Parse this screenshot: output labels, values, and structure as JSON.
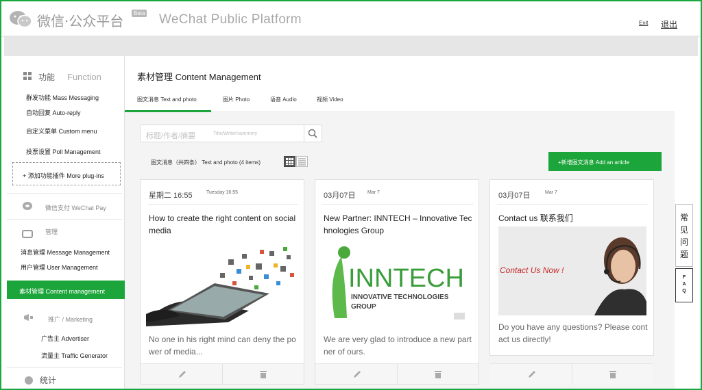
{
  "header": {
    "brand_cn": "微信·公众平台",
    "beta": "Beta",
    "brand_en": "WeChat Public Platform",
    "exit_en": "Exit",
    "exit_cn": "退出"
  },
  "sidebar": {
    "function_cn": "功能",
    "function_en": "Function",
    "items": [
      {
        "label": "群发功能 Mass Messaging"
      },
      {
        "label": "自动回复 Auto-reply"
      },
      {
        "label": "自定义菜单 Custom menu"
      },
      {
        "label": "投票设置 Poll Management"
      }
    ],
    "plugins_label": "+ 添加功能插件 More plug-ins",
    "wechat_pay": "微信支付 WeChat Pay",
    "manage": "管理",
    "manage_items": [
      {
        "label": "消息管理 Message Management"
      },
      {
        "label": "用户管理 User Management"
      }
    ],
    "active_item": "素材管理 Content management",
    "marketing": "推广 / Marketing",
    "marketing_items": [
      {
        "label": "广告主 Advertiser"
      },
      {
        "label": "流量主 Traffic Generator"
      }
    ],
    "stats": "统计"
  },
  "content": {
    "title": "素材管理 Content Management",
    "tabs": [
      {
        "label": "图文消息 Text and photo"
      },
      {
        "label": "图片 Photo"
      },
      {
        "label": "语音 Audio"
      },
      {
        "label": "视频 Video"
      }
    ],
    "search": {
      "placeholder_cn": "标题/作者/摘要",
      "placeholder_en": "Title/Writer/summery"
    },
    "count_label": "图文消息（共四条） Text and photo (4 items)",
    "add_button": "+新增图文消息 Add an article"
  },
  "cards": [
    {
      "date": "星期二 16:55",
      "date_en": "Tuesday 16:55",
      "title": "How to create the right content on social media",
      "description": "No one in his right mind can deny the power of media..."
    },
    {
      "date": "03月07日",
      "date_en": "Mar 7",
      "title": "New Partner: INNTECH – Innovative Technologies Group",
      "logo_main": "INNTECH",
      "logo_sub1": "INNOVATIVE TECHNOLOGIES",
      "logo_sub2": "GROUP",
      "description": "We are very glad to introduce a new partner of ours."
    },
    {
      "date": "03月07日",
      "date_en": "Mar 7",
      "title": "Contact us 联系我们",
      "image_text": "Contact Us Now !",
      "description": "Do you have any questions? Please contact us directly!"
    }
  ],
  "float": {
    "cn": [
      "常",
      "见",
      "问",
      "题"
    ],
    "en": [
      "F",
      "A",
      "Q"
    ]
  },
  "colors": {
    "accent": "#1ca53a"
  }
}
